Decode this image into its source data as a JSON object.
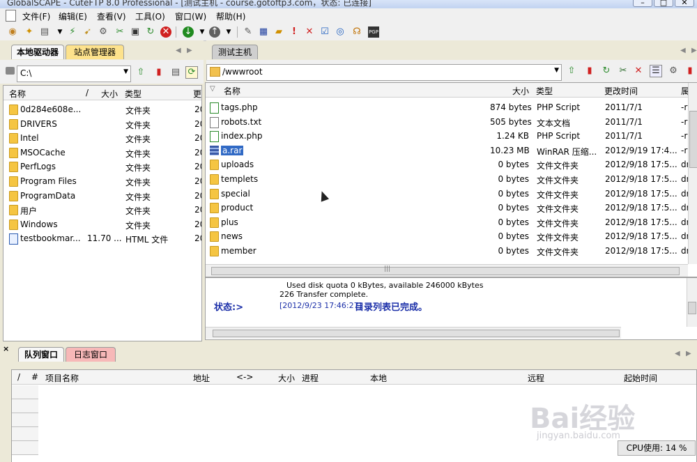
{
  "window": {
    "title": "GlobalSCAPE - CuteFTP 8.0 Professional - [测试主机 - course.gotoftp3.com，状态: 已连接]"
  },
  "menu": [
    "文件(F)",
    "编辑(E)",
    "查看(V)",
    "工具(O)",
    "窗口(W)",
    "帮助(H)"
  ],
  "left_pane": {
    "tabs": [
      "本地驱动器",
      "站点管理器"
    ],
    "path": "C:\\",
    "columns": [
      "名称",
      "/",
      "大小",
      "类型",
      "更"
    ],
    "rows": [
      {
        "name": "0d284e608e...",
        "size": "",
        "type": "文件夹",
        "mod": "20",
        "icon": "folder-icon"
      },
      {
        "name": "DRIVERS",
        "size": "",
        "type": "文件夹",
        "mod": "20",
        "icon": "folder-icon"
      },
      {
        "name": "Intel",
        "size": "",
        "type": "文件夹",
        "mod": "20",
        "icon": "folder-icon"
      },
      {
        "name": "MSOCache",
        "size": "",
        "type": "文件夹",
        "mod": "20",
        "icon": "folder-icon"
      },
      {
        "name": "PerfLogs",
        "size": "",
        "type": "文件夹",
        "mod": "20",
        "icon": "folder-icon"
      },
      {
        "name": "Program Files",
        "size": "",
        "type": "文件夹",
        "mod": "20",
        "icon": "folder-icon"
      },
      {
        "name": "ProgramData",
        "size": "",
        "type": "文件夹",
        "mod": "20",
        "icon": "folder-icon"
      },
      {
        "name": "用户",
        "size": "",
        "type": "文件夹",
        "mod": "20",
        "icon": "folder-icon"
      },
      {
        "name": "Windows",
        "size": "",
        "type": "文件夹",
        "mod": "20",
        "icon": "folder-icon"
      },
      {
        "name": "testbookmar...",
        "size": "11.70 ...",
        "type": "HTML 文件",
        "mod": "20",
        "icon": "html-file-icon"
      }
    ]
  },
  "right_pane": {
    "tabs": [
      "测试主机"
    ],
    "path": "/wwwroot",
    "columns": [
      "名称",
      "大小",
      "类型",
      "更改时间",
      "属"
    ],
    "rows": [
      {
        "name": "tags.php",
        "size": "874 bytes",
        "type": "PHP Script",
        "date": "2011/7/1",
        "attr": "-rw",
        "icon": "php-file-icon"
      },
      {
        "name": "robots.txt",
        "size": "505 bytes",
        "type": "文本文档",
        "date": "2011/7/1",
        "attr": "-rw",
        "icon": "text-file-icon"
      },
      {
        "name": "index.php",
        "size": "1.24 KB",
        "type": "PHP Script",
        "date": "2011/7/1",
        "attr": "-rw",
        "icon": "php-file-icon"
      },
      {
        "name": "a.rar",
        "size": "10.23 MB",
        "type": "WinRAR 压缩...",
        "date": "2012/9/19 17:4...",
        "attr": "-rw",
        "icon": "rar-file-icon"
      },
      {
        "name": "uploads",
        "size": "0 bytes",
        "type": "文件文件夹",
        "date": "2012/9/18 17:5...",
        "attr": "dr",
        "icon": "folder-icon"
      },
      {
        "name": "templets",
        "size": "0 bytes",
        "type": "文件文件夹",
        "date": "2012/9/18 17:5...",
        "attr": "dr",
        "icon": "folder-icon"
      },
      {
        "name": "special",
        "size": "0 bytes",
        "type": "文件文件夹",
        "date": "2012/9/18 17:5...",
        "attr": "dr",
        "icon": "folder-icon"
      },
      {
        "name": "product",
        "size": "0 bytes",
        "type": "文件文件夹",
        "date": "2012/9/18 17:5...",
        "attr": "dr",
        "icon": "folder-icon"
      },
      {
        "name": "plus",
        "size": "0 bytes",
        "type": "文件文件夹",
        "date": "2012/9/18 17:5...",
        "attr": "dr",
        "icon": "folder-icon"
      },
      {
        "name": "news",
        "size": "0 bytes",
        "type": "文件文件夹",
        "date": "2012/9/18 17:5...",
        "attr": "dr",
        "icon": "folder-icon"
      },
      {
        "name": "member",
        "size": "0 bytes",
        "type": "文件文件夹",
        "date": "2012/9/18 17:5...",
        "attr": "dr",
        "icon": "folder-icon"
      }
    ],
    "selected_row": "a.rar"
  },
  "log": {
    "line1": "Used disk quota 0 kBytes, available 246000 kBytes",
    "line2": "226 Transfer complete.",
    "status_label": "状态:>",
    "timestamp": "[2012/9/23 17:46:27]",
    "message": "目录列表已完成。"
  },
  "queue": {
    "tabs": [
      "队列窗口",
      "日志窗口"
    ],
    "columns": [
      "/",
      "#",
      "项目名称",
      "地址",
      "<->",
      "大小",
      "进程",
      "本地",
      "远程",
      "起始时间"
    ]
  },
  "status_bar": {
    "cpu": "CPU使用: 14 %"
  },
  "watermark": {
    "brand": "Bai经验",
    "url": "jingyan.baidu.com"
  }
}
